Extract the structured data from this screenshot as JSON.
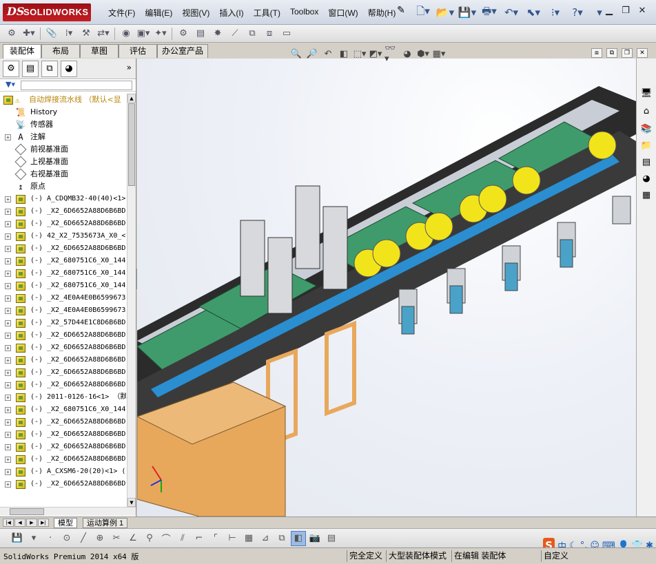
{
  "app": {
    "logo_mark": "DS",
    "logo_text": "SOLIDWORKS"
  },
  "menu": [
    "文件(F)",
    "编辑(E)",
    "视图(V)",
    "插入(I)",
    "工具(T)",
    "Toolbox",
    "窗口(W)",
    "帮助(H)"
  ],
  "command_tabs": [
    "装配体",
    "布局",
    "草图",
    "评估",
    "办公室产品"
  ],
  "feature_tree": {
    "root": "自动焊接流水线 （默认<显",
    "fixed_items": [
      "History",
      "传感器",
      "注解",
      "前视基准面",
      "上视基准面",
      "右视基准面",
      "原点"
    ],
    "components": [
      "A_CDQMB32-40(40)<1>",
      "_X2_6D6652A88D6B6BD",
      "_X2_6D6652A88D6B6BD",
      "42_X2_7535673A_X0_<",
      "_X2_6D6652A88D6B6BD",
      "_X2_680751C6_X0_144",
      "_X2_680751C6_X0_144",
      "_X2_680751C6_X0_144",
      "_X2_4E0A4E0B6599673",
      "_X2_4E0A4E0B6599673",
      "_X2_57D44E1C8D6B6BD",
      "_X2_6D6652A88D6B6BD",
      "_X2_6D6652A88D6B6BD",
      "_X2_6D6652A88D6B6BD",
      "_X2_6D6652A88D6B6BD",
      "_X2_6D6652A88D6B6BD",
      "2011-0126-16<1> （默",
      "_X2_680751C6_X0_144",
      "_X2_6D6652A88D6B6BD",
      "_X2_6D6652A88D6B6BD",
      "_X2_6D6652A88D6B6BD",
      "_X2_6D6652A88D6B6BD",
      "A_CXSM6-20(20)<1> (",
      "_X2_6D6652A88D6B6BD"
    ],
    "component_prefix": "(-)"
  },
  "bottom_tabs": [
    "模型",
    "运动算例 1"
  ],
  "ime": {
    "zhong": "中"
  },
  "status": {
    "product": "SolidWorks Premium 2014 x64 版",
    "fully_defined": "完全定义",
    "large_assembly": "大型装配体模式",
    "editing": "在编辑 装配体",
    "custom": "自定义"
  },
  "colors": {
    "tree_root": "#b8860b",
    "panel_green": "#3f9b6b",
    "cylinder_yellow": "#f2e41a",
    "cabinet_orange": "#e8a85c",
    "accent_blue": "#2a8ed0"
  }
}
